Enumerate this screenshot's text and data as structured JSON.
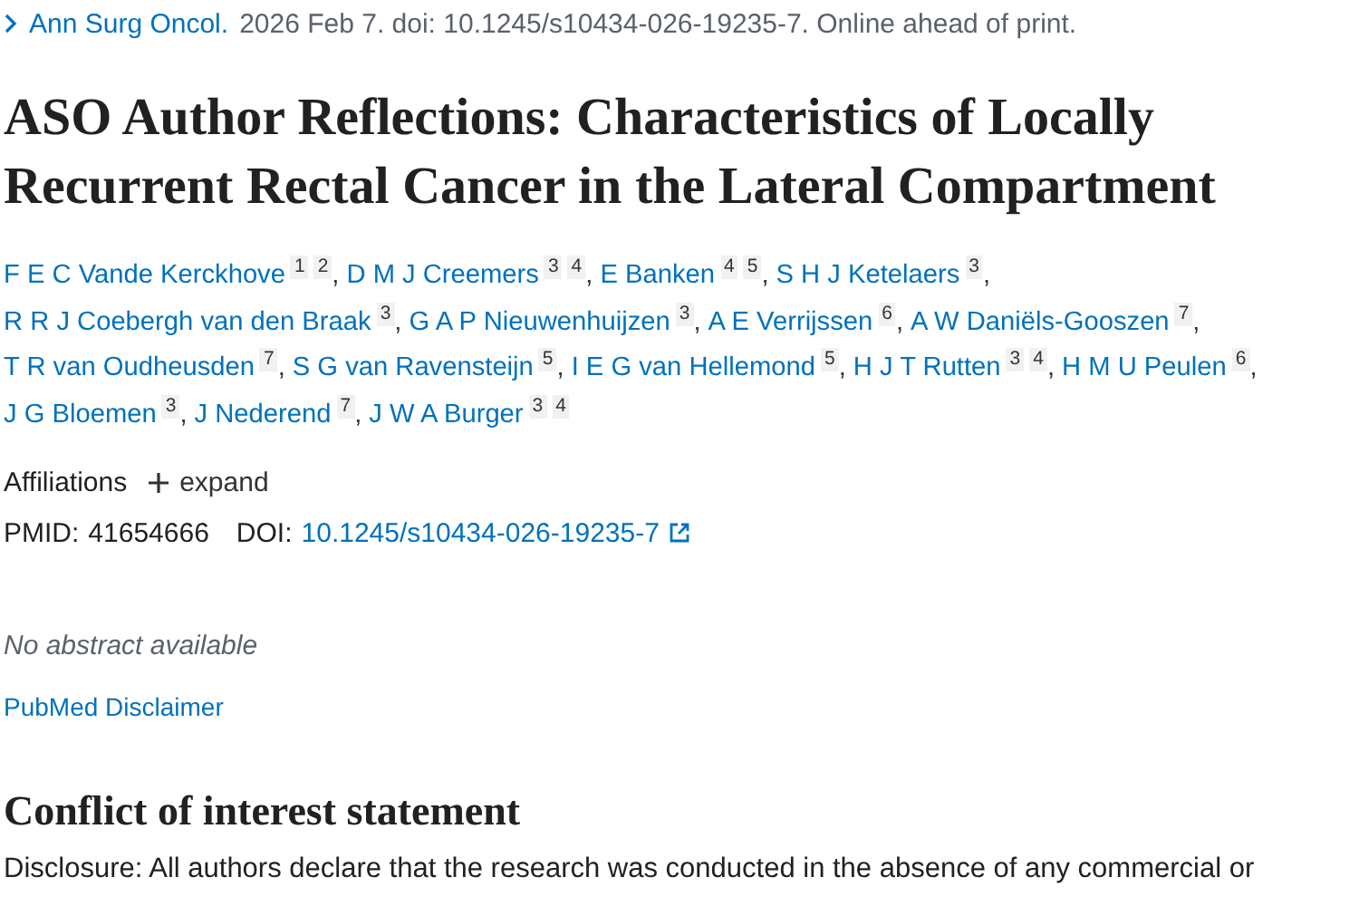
{
  "citation": {
    "journal": "Ann Surg Oncol.",
    "details": "2026 Feb 7. doi: 10.1245/s10434-026-19235-7. Online ahead of print."
  },
  "title": "ASO Author Reflections: Characteristics of Locally Recurrent Rectal Cancer in the Lateral Compartment",
  "authors": [
    {
      "name": "F E C Vande Kerckhove",
      "affiliations": [
        "1",
        "2"
      ]
    },
    {
      "name": "D M J Creemers",
      "affiliations": [
        "3",
        "4"
      ]
    },
    {
      "name": "E Banken",
      "affiliations": [
        "4",
        "5"
      ]
    },
    {
      "name": "S H J Ketelaers",
      "affiliations": [
        "3"
      ]
    },
    {
      "name": "R R J Coebergh van den Braak",
      "affiliations": [
        "3"
      ]
    },
    {
      "name": "G A P Nieuwenhuijzen",
      "affiliations": [
        "3"
      ]
    },
    {
      "name": "A E Verrijssen",
      "affiliations": [
        "6"
      ]
    },
    {
      "name": "A W Daniëls-Gooszen",
      "affiliations": [
        "7"
      ]
    },
    {
      "name": "T R van Oudheusden",
      "affiliations": [
        "7"
      ]
    },
    {
      "name": "S G van Ravensteijn",
      "affiliations": [
        "5"
      ]
    },
    {
      "name": "I E G van Hellemond",
      "affiliations": [
        "5"
      ]
    },
    {
      "name": "H J T Rutten",
      "affiliations": [
        "3",
        "4"
      ]
    },
    {
      "name": "H M U Peulen",
      "affiliations": [
        "6"
      ]
    },
    {
      "name": "J G Bloemen",
      "affiliations": [
        "3"
      ]
    },
    {
      "name": "J Nederend",
      "affiliations": [
        "7"
      ]
    },
    {
      "name": "J W A Burger",
      "affiliations": [
        "3",
        "4"
      ]
    }
  ],
  "author_separator": ",",
  "affiliations": {
    "label": "Affiliations",
    "toggle": "expand",
    "expanded": false
  },
  "identifiers": {
    "pmid_label": "PMID:",
    "pmid": "41654666",
    "doi_label": "DOI:",
    "doi": "10.1245/s10434-026-19235-7"
  },
  "abstract_note": "No abstract available",
  "disclaimer_link": "PubMed Disclaimer",
  "conflict": {
    "heading": "Conflict of interest statement",
    "text": "Disclosure: All authors declare that the research was conducted in the absence of any commercial or"
  }
}
